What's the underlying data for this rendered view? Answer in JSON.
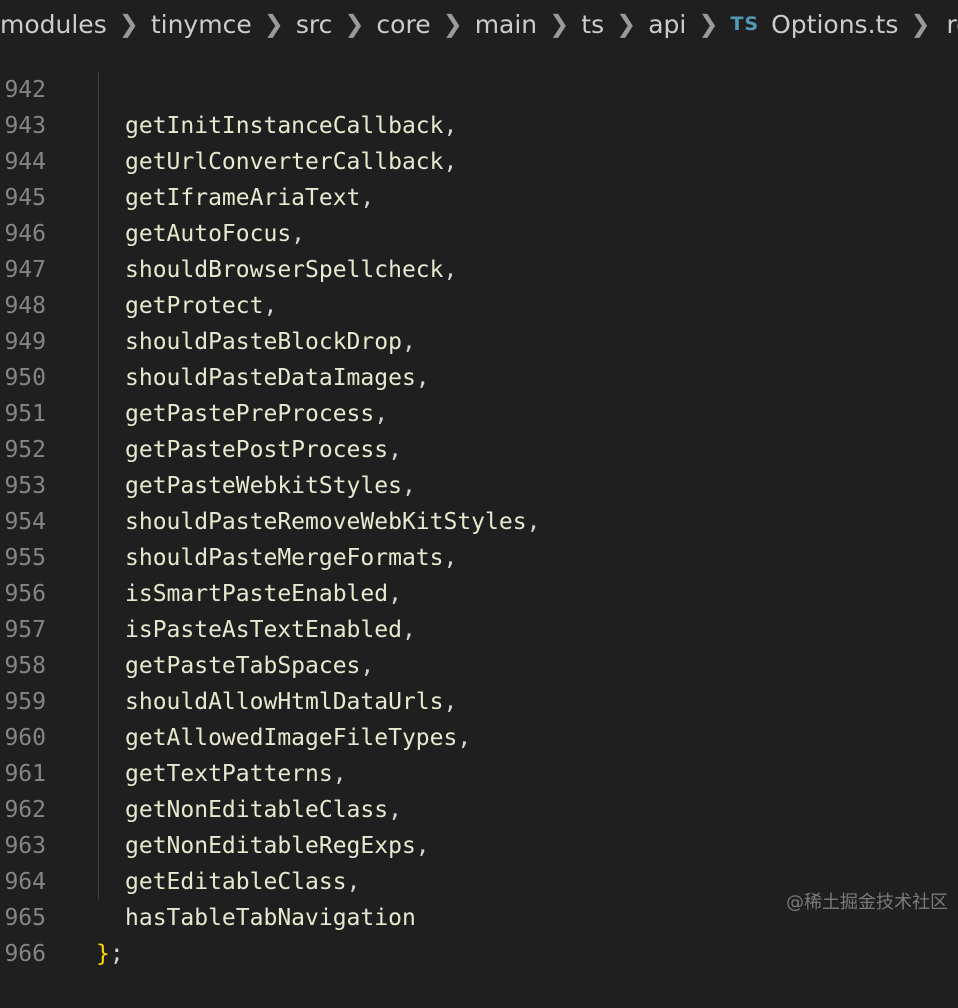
{
  "breadcrumb": {
    "items": [
      "modules",
      "tinymce",
      "src",
      "core",
      "main",
      "ts",
      "api"
    ],
    "file_type_badge": "TS",
    "file_name": "Options.ts",
    "symbol_name": "register"
  },
  "editor": {
    "lines": [
      {
        "number": "942",
        "text": "getInitInstanceCallback",
        "punct": ","
      },
      {
        "number": "943",
        "text": "getUrlConverterCallback",
        "punct": ","
      },
      {
        "number": "944",
        "text": "getIframeAriaText",
        "punct": ","
      },
      {
        "number": "945",
        "text": "getAutoFocus",
        "punct": ","
      },
      {
        "number": "946",
        "text": "shouldBrowserSpellcheck",
        "punct": ","
      },
      {
        "number": "947",
        "text": "getProtect",
        "punct": ","
      },
      {
        "number": "948",
        "text": "shouldPasteBlockDrop",
        "punct": ","
      },
      {
        "number": "949",
        "text": "shouldPasteDataImages",
        "punct": ","
      },
      {
        "number": "950",
        "text": "getPastePreProcess",
        "punct": ","
      },
      {
        "number": "951",
        "text": "getPastePostProcess",
        "punct": ","
      },
      {
        "number": "952",
        "text": "getPasteWebkitStyles",
        "punct": ","
      },
      {
        "number": "953",
        "text": "shouldPasteRemoveWebKitStyles",
        "punct": ","
      },
      {
        "number": "954",
        "text": "shouldPasteMergeFormats",
        "punct": ","
      },
      {
        "number": "955",
        "text": "isSmartPasteEnabled",
        "punct": ","
      },
      {
        "number": "956",
        "text": "isPasteAsTextEnabled",
        "punct": ","
      },
      {
        "number": "957",
        "text": "getPasteTabSpaces",
        "punct": ","
      },
      {
        "number": "958",
        "text": "shouldAllowHtmlDataUrls",
        "punct": ","
      },
      {
        "number": "959",
        "text": "getAllowedImageFileTypes",
        "punct": ","
      },
      {
        "number": "960",
        "text": "getTextPatterns",
        "punct": ","
      },
      {
        "number": "961",
        "text": "getNonEditableClass",
        "punct": ","
      },
      {
        "number": "962",
        "text": "getNonEditableRegExps",
        "punct": ","
      },
      {
        "number": "963",
        "text": "getEditableClass",
        "punct": ","
      },
      {
        "number": "964",
        "text": "hasTableTabNavigation",
        "punct": ""
      }
    ],
    "closing_line": {
      "number": "965",
      "brace": "}",
      "punct": ";"
    },
    "next_line_number": "966"
  },
  "watermark": "@稀土掘金技术社区",
  "colors": {
    "background": "#1f1f1f",
    "line_number": "#858585",
    "identifier": "#e8e8d0",
    "brace": "#ffd700",
    "ts_badge": "#519aba"
  }
}
